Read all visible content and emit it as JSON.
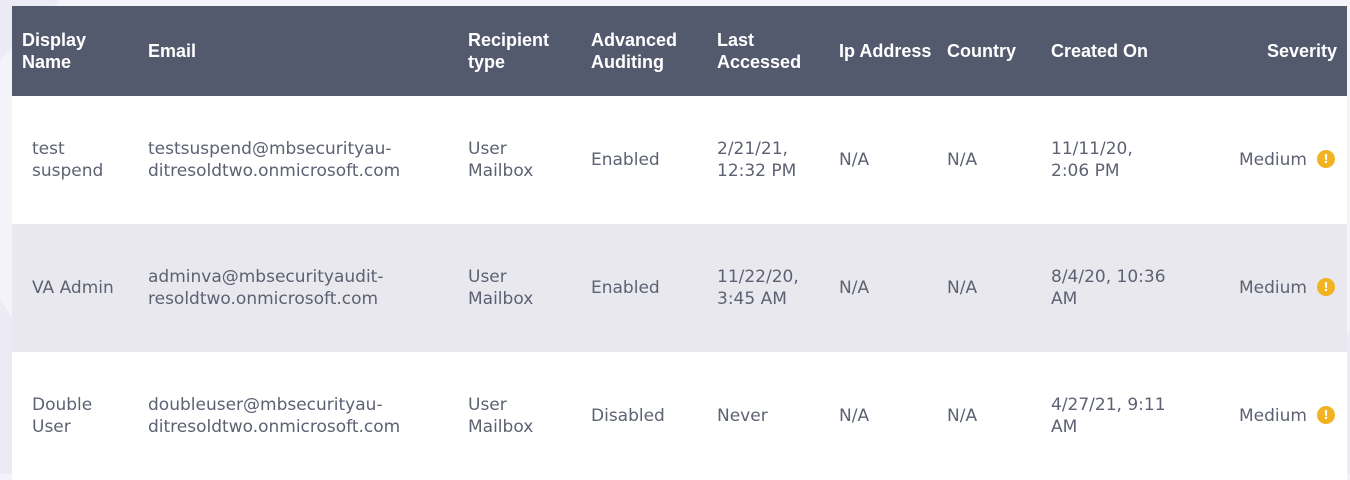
{
  "colors": {
    "header_bg": "#535a6e",
    "header_text": "#ffffff",
    "row_alt_bg": "#e8e8ee",
    "cell_text": "#5d6273",
    "severity_medium": "#f2b322"
  },
  "table": {
    "headers": {
      "display_name": "Display Name",
      "email": "Email",
      "recipient_type": "Recipient type",
      "advanced_auditing": "Advanced Auditing",
      "last_accessed": "Last Accessed",
      "ip_address": "Ip Address",
      "country": "Country",
      "created_on": "Created On",
      "severity": "Severity"
    },
    "rows": [
      {
        "display_name": "test suspend",
        "email": "testsuspend@mbsecurityau-ditresoldtwo.onmicrosoft.com",
        "recipient_type": "User Mailbox",
        "advanced_auditing": "Enabled",
        "last_accessed": "2/21/21, 12:32 PM",
        "ip_address": "N/A",
        "country": "N/A",
        "created_on": "11/11/20, 2:06 PM",
        "severity": "Medium",
        "severity_icon": "warning-circle-icon",
        "severity_glyph": "!"
      },
      {
        "display_name": "VA Admin",
        "email": "adminva@mbsecurityaudit-resoldtwo.onmicrosoft.com",
        "recipient_type": "User Mailbox",
        "advanced_auditing": "Enabled",
        "last_accessed": "11/22/20, 3:45 AM",
        "ip_address": "N/A",
        "country": "N/A",
        "created_on": "8/4/20, 10:36 AM",
        "severity": "Medium",
        "severity_icon": "warning-circle-icon",
        "severity_glyph": "!"
      },
      {
        "display_name": "Double User",
        "email": "doubleuser@mbsecurityau-ditresoldtwo.onmicrosoft.com",
        "recipient_type": "User Mailbox",
        "advanced_auditing": "Disabled",
        "last_accessed": "Never",
        "ip_address": "N/A",
        "country": "N/A",
        "created_on": "4/27/21, 9:11 AM",
        "severity": "Medium",
        "severity_icon": "warning-circle-icon",
        "severity_glyph": "!"
      }
    ]
  }
}
